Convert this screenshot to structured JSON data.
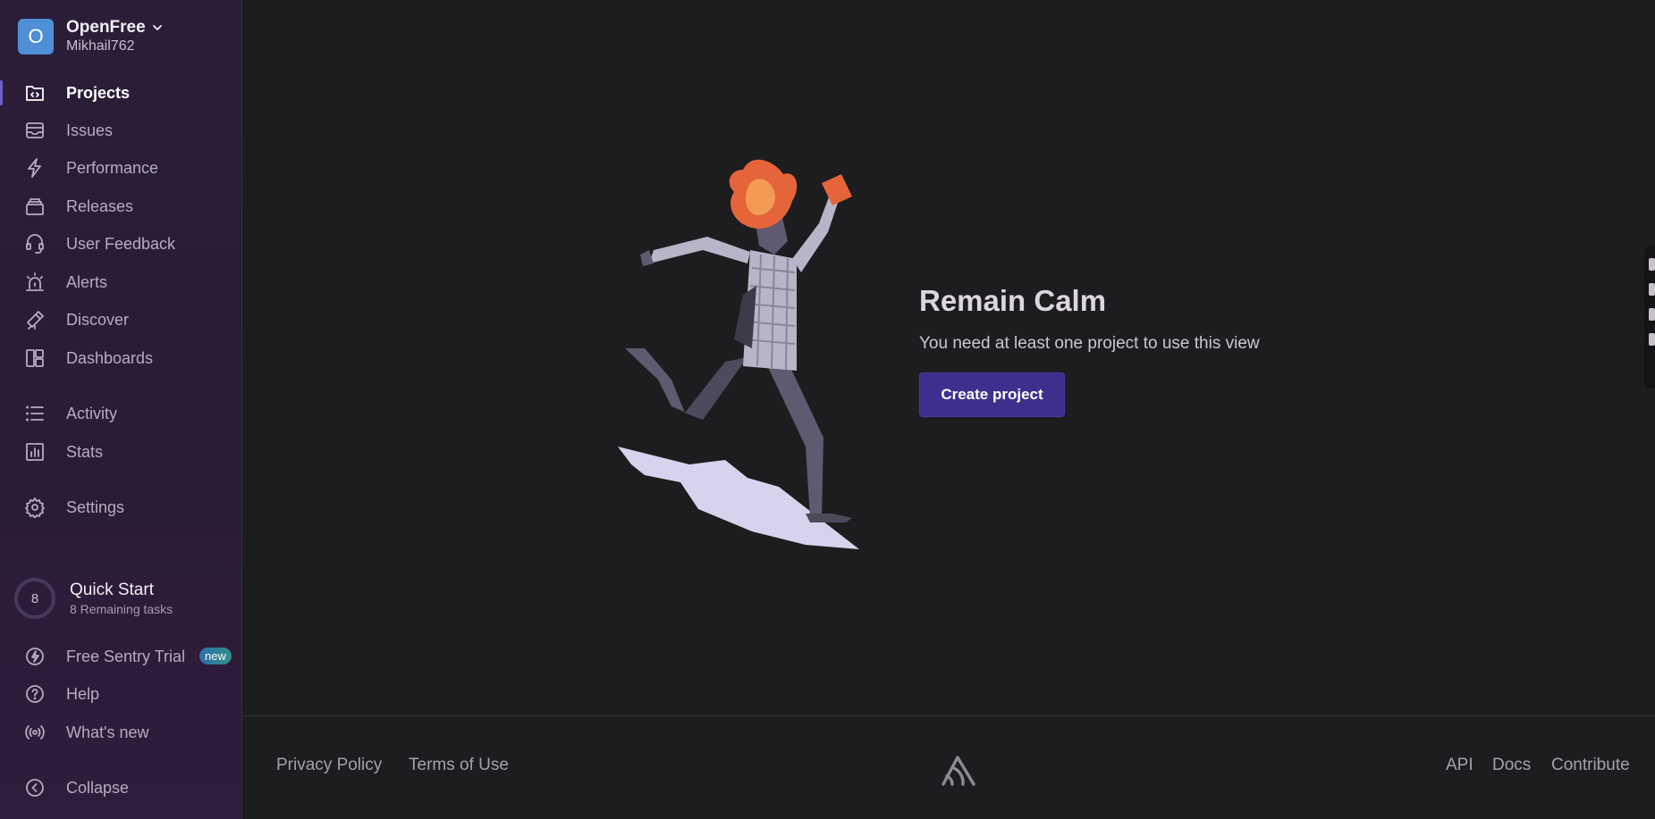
{
  "sidebar": {
    "org": {
      "avatar_letter": "O",
      "name": "OpenFree",
      "user": "Mikhail762"
    },
    "nav": [
      {
        "label": "Projects",
        "icon": "projects-icon"
      },
      {
        "label": "Issues",
        "icon": "issues-icon"
      },
      {
        "label": "Performance",
        "icon": "performance-icon"
      },
      {
        "label": "Releases",
        "icon": "releases-icon"
      },
      {
        "label": "User Feedback",
        "icon": "user-feedback-icon"
      },
      {
        "label": "Alerts",
        "icon": "alerts-icon"
      },
      {
        "label": "Discover",
        "icon": "discover-icon"
      },
      {
        "label": "Dashboards",
        "icon": "dashboards-icon"
      },
      {
        "label": "Activity",
        "icon": "activity-icon"
      },
      {
        "label": "Stats",
        "icon": "stats-icon"
      },
      {
        "label": "Settings",
        "icon": "settings-icon"
      }
    ],
    "quick_start": {
      "count": "8",
      "title": "Quick Start",
      "subtitle": "8 Remaining tasks"
    },
    "bottom": [
      {
        "label": "Free Sentry Trial",
        "icon": "lightning-icon",
        "badge": "new"
      },
      {
        "label": "Help",
        "icon": "help-icon"
      },
      {
        "label": "What's new",
        "icon": "broadcast-icon"
      },
      {
        "label": "Collapse",
        "icon": "collapse-icon"
      }
    ]
  },
  "main": {
    "title": "Remain Calm",
    "description": "You need at least one project to use this view",
    "create_button": "Create project"
  },
  "footer": {
    "privacy": "Privacy Policy",
    "terms": "Terms of Use",
    "api": "API",
    "docs": "Docs",
    "contribute": "Contribute"
  },
  "colors": {
    "sidebar_bg": "#2b1d38",
    "main_bg": "#1d1d1f",
    "accent": "#3e2f8f",
    "avatar": "#4f8fd6"
  }
}
